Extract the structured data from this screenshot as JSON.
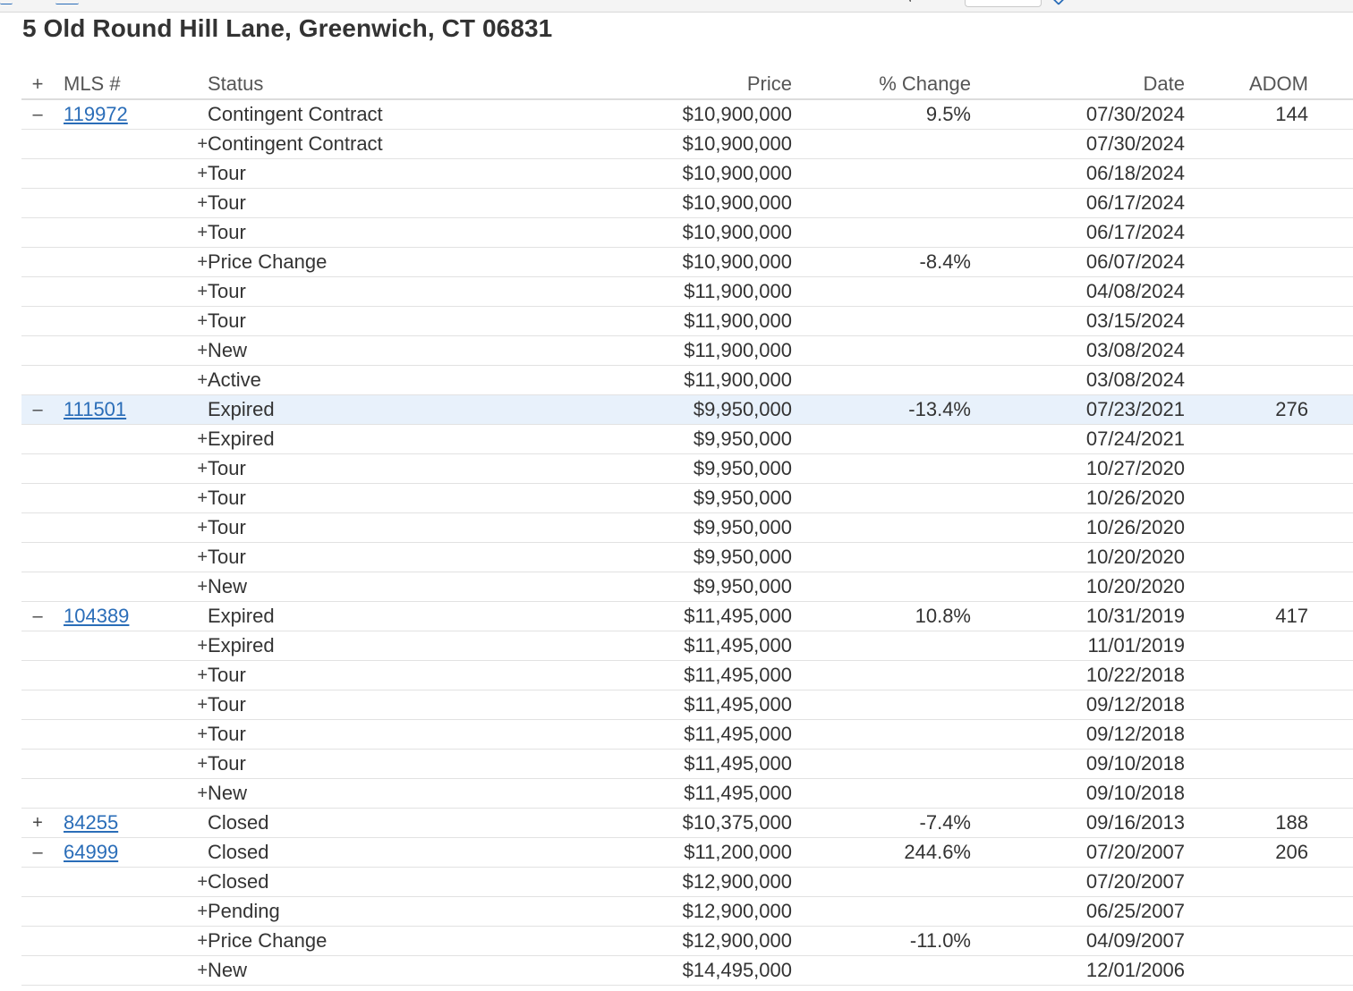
{
  "address": "5 Old Round Hill Lane, Greenwich, CT 06831",
  "headers": {
    "toggle": "+",
    "mls": "MLS #",
    "status": "Status",
    "price": "Price",
    "change": "% Change",
    "date": "Date",
    "adom": "ADOM"
  },
  "rows": [
    {
      "kind": "group",
      "toggle": "–",
      "mls": "119972",
      "status": "Contingent Contract",
      "price": "$10,900,000",
      "change": "9.5%",
      "date": "07/30/2024",
      "adom": "144"
    },
    {
      "kind": "sub",
      "toggle": "+",
      "status": "Contingent Contract",
      "price": "$10,900,000",
      "change": "",
      "date": "07/30/2024"
    },
    {
      "kind": "sub",
      "toggle": "+",
      "status": "Tour",
      "price": "$10,900,000",
      "change": "",
      "date": "06/18/2024"
    },
    {
      "kind": "sub",
      "toggle": "+",
      "status": "Tour",
      "price": "$10,900,000",
      "change": "",
      "date": "06/17/2024"
    },
    {
      "kind": "sub",
      "toggle": "+",
      "status": "Tour",
      "price": "$10,900,000",
      "change": "",
      "date": "06/17/2024"
    },
    {
      "kind": "sub",
      "toggle": "+",
      "status": "Price Change",
      "price": "$10,900,000",
      "change": "-8.4%",
      "date": "06/07/2024"
    },
    {
      "kind": "sub",
      "toggle": "+",
      "status": "Tour",
      "price": "$11,900,000",
      "change": "",
      "date": "04/08/2024"
    },
    {
      "kind": "sub",
      "toggle": "+",
      "status": "Tour",
      "price": "$11,900,000",
      "change": "",
      "date": "03/15/2024"
    },
    {
      "kind": "sub",
      "toggle": "+",
      "status": "New",
      "price": "$11,900,000",
      "change": "",
      "date": "03/08/2024"
    },
    {
      "kind": "sub",
      "toggle": "+",
      "status": "Active",
      "price": "$11,900,000",
      "change": "",
      "date": "03/08/2024"
    },
    {
      "kind": "group",
      "highlight": true,
      "toggle": "–",
      "mls": "111501",
      "status": "Expired",
      "price": "$9,950,000",
      "change": "-13.4%",
      "date": "07/23/2021",
      "adom": "276"
    },
    {
      "kind": "sub",
      "toggle": "+",
      "status": "Expired",
      "price": "$9,950,000",
      "change": "",
      "date": "07/24/2021"
    },
    {
      "kind": "sub",
      "toggle": "+",
      "status": "Tour",
      "price": "$9,950,000",
      "change": "",
      "date": "10/27/2020"
    },
    {
      "kind": "sub",
      "toggle": "+",
      "status": "Tour",
      "price": "$9,950,000",
      "change": "",
      "date": "10/26/2020"
    },
    {
      "kind": "sub",
      "toggle": "+",
      "status": "Tour",
      "price": "$9,950,000",
      "change": "",
      "date": "10/26/2020"
    },
    {
      "kind": "sub",
      "toggle": "+",
      "status": "Tour",
      "price": "$9,950,000",
      "change": "",
      "date": "10/20/2020"
    },
    {
      "kind": "sub",
      "toggle": "+",
      "status": "New",
      "price": "$9,950,000",
      "change": "",
      "date": "10/20/2020"
    },
    {
      "kind": "group",
      "toggle": "–",
      "mls": "104389",
      "status": "Expired",
      "price": "$11,495,000",
      "change": "10.8%",
      "date": "10/31/2019",
      "adom": "417"
    },
    {
      "kind": "sub",
      "toggle": "+",
      "status": "Expired",
      "price": "$11,495,000",
      "change": "",
      "date": "11/01/2019"
    },
    {
      "kind": "sub",
      "toggle": "+",
      "status": "Tour",
      "price": "$11,495,000",
      "change": "",
      "date": "10/22/2018"
    },
    {
      "kind": "sub",
      "toggle": "+",
      "status": "Tour",
      "price": "$11,495,000",
      "change": "",
      "date": "09/12/2018"
    },
    {
      "kind": "sub",
      "toggle": "+",
      "status": "Tour",
      "price": "$11,495,000",
      "change": "",
      "date": "09/12/2018"
    },
    {
      "kind": "sub",
      "toggle": "+",
      "status": "Tour",
      "price": "$11,495,000",
      "change": "",
      "date": "09/10/2018"
    },
    {
      "kind": "sub",
      "toggle": "+",
      "status": "New",
      "price": "$11,495,000",
      "change": "",
      "date": "09/10/2018"
    },
    {
      "kind": "group",
      "toggle": "+",
      "mls": "84255",
      "status": "Closed",
      "price": "$10,375,000",
      "change": "-7.4%",
      "date": "09/16/2013",
      "adom": "188"
    },
    {
      "kind": "group",
      "toggle": "–",
      "mls": "64999",
      "status": "Closed",
      "price": "$11,200,000",
      "change": "244.6%",
      "date": "07/20/2007",
      "adom": "206"
    },
    {
      "kind": "sub",
      "toggle": "+",
      "status": "Closed",
      "price": "$12,900,000",
      "change": "",
      "date": "07/20/2007"
    },
    {
      "kind": "sub",
      "toggle": "+",
      "status": "Pending",
      "price": "$12,900,000",
      "change": "",
      "date": "06/25/2007"
    },
    {
      "kind": "sub",
      "toggle": "+",
      "status": "Price Change",
      "price": "$12,900,000",
      "change": "-11.0%",
      "date": "04/09/2007"
    },
    {
      "kind": "sub",
      "toggle": "+",
      "status": "New",
      "price": "$14,495,000",
      "change": "",
      "date": "12/01/2006"
    }
  ]
}
